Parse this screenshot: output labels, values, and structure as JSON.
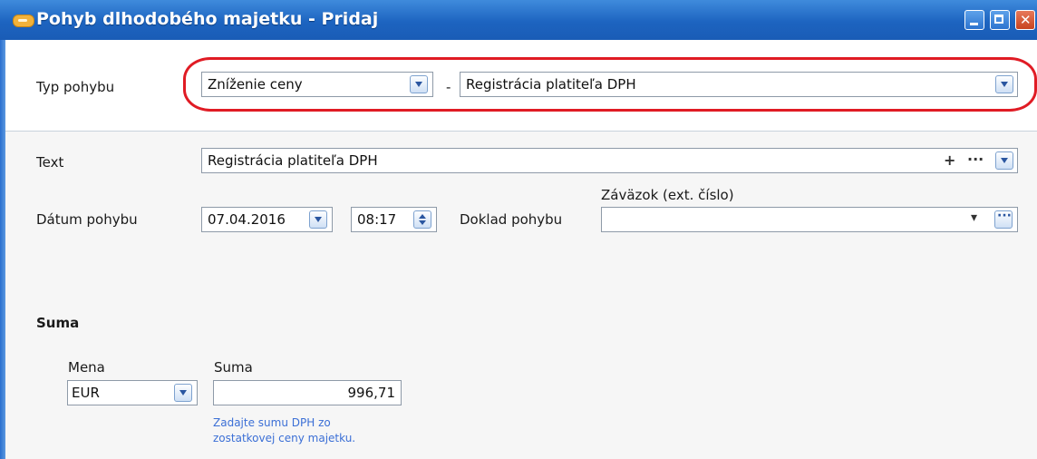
{
  "window": {
    "title": "Pohyb dlhodobého majetku - Pridaj"
  },
  "movement": {
    "type_label": "Typ pohybu",
    "type_value": "Zníženie ceny",
    "separator": "-",
    "subtype_value": "Registrácia platiteľa DPH"
  },
  "text_field": {
    "label": "Text",
    "value": "Registrácia platiteľa DPH",
    "plus": "+",
    "more": "···"
  },
  "date": {
    "label": "Dátum pohybu",
    "value": "07.04.2016",
    "time": "08:17"
  },
  "document": {
    "label": "Doklad pohybu",
    "caption": "Záväzok (ext. číslo)",
    "value": "",
    "arrow": "▾"
  },
  "amount_section": {
    "title": "Suma",
    "currency_label": "Mena",
    "currency_value": "EUR",
    "amount_label": "Suma",
    "amount_value": "996,71",
    "hint_line1": "Zadajte sumu DPH zo",
    "hint_line2": "zostatkovej ceny majetku."
  },
  "colors": {
    "titlebar": "#1d64c0",
    "highlight": "#e01b24",
    "hint": "#3b6fd6"
  }
}
